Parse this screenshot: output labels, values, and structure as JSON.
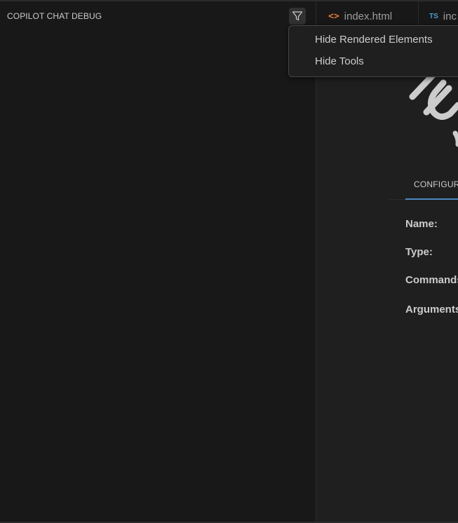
{
  "panel": {
    "title": "COPILOT CHAT DEBUG",
    "filter_icon": "filter-icon"
  },
  "filter_menu": {
    "items": [
      {
        "label": "Hide Rendered Elements"
      },
      {
        "label": "Hide Tools"
      }
    ]
  },
  "editor": {
    "tabs": [
      {
        "icon": "<>",
        "icon_name": "html-file-icon",
        "label": "index.html"
      },
      {
        "icon": "TS",
        "icon_name": "typescript-file-icon",
        "label": "inc"
      }
    ],
    "content": {
      "config_tab": "CONFIGUR",
      "fields": [
        "Name:",
        "Type:",
        "Commands",
        "Arguments"
      ]
    }
  },
  "colors": {
    "background": "#181818",
    "editor_background": "#1f1f1f",
    "accent": "#4e87c4",
    "html_icon": "#e37933",
    "ts_icon": "#4b9cd3"
  }
}
